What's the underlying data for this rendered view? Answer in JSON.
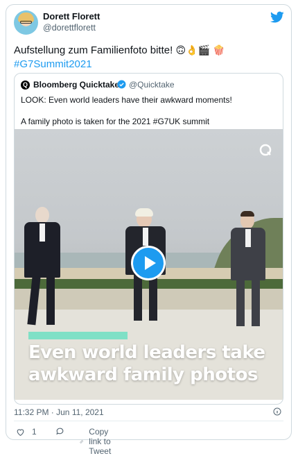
{
  "author": {
    "name": "Dorett Florett",
    "handle": "@dorettflorett"
  },
  "tweet": {
    "text": "Aufstellung zum Familienfoto bitte!",
    "emojis": "🙃👌🎬 🍿",
    "hashtag": "#G7Summit2021"
  },
  "quote": {
    "name": "Bloomberg Quicktake",
    "handle": "@Quicktake",
    "line1": "LOOK: Even world leaders have their awkward moments!",
    "line2": "A family photo is taken for the 2021 #G7UK summit",
    "video_caption_line1": "Even world leaders take",
    "video_caption_line2": "awkward family photos"
  },
  "meta": {
    "timestamp": "11:32 PM · Jun 11, 2021"
  },
  "actions": {
    "likes": "1",
    "copy_link": "Copy link to Tweet"
  },
  "colors": {
    "accent": "#1d9bf0",
    "muted": "#536471",
    "caption_bar": "#7fe0c6"
  }
}
